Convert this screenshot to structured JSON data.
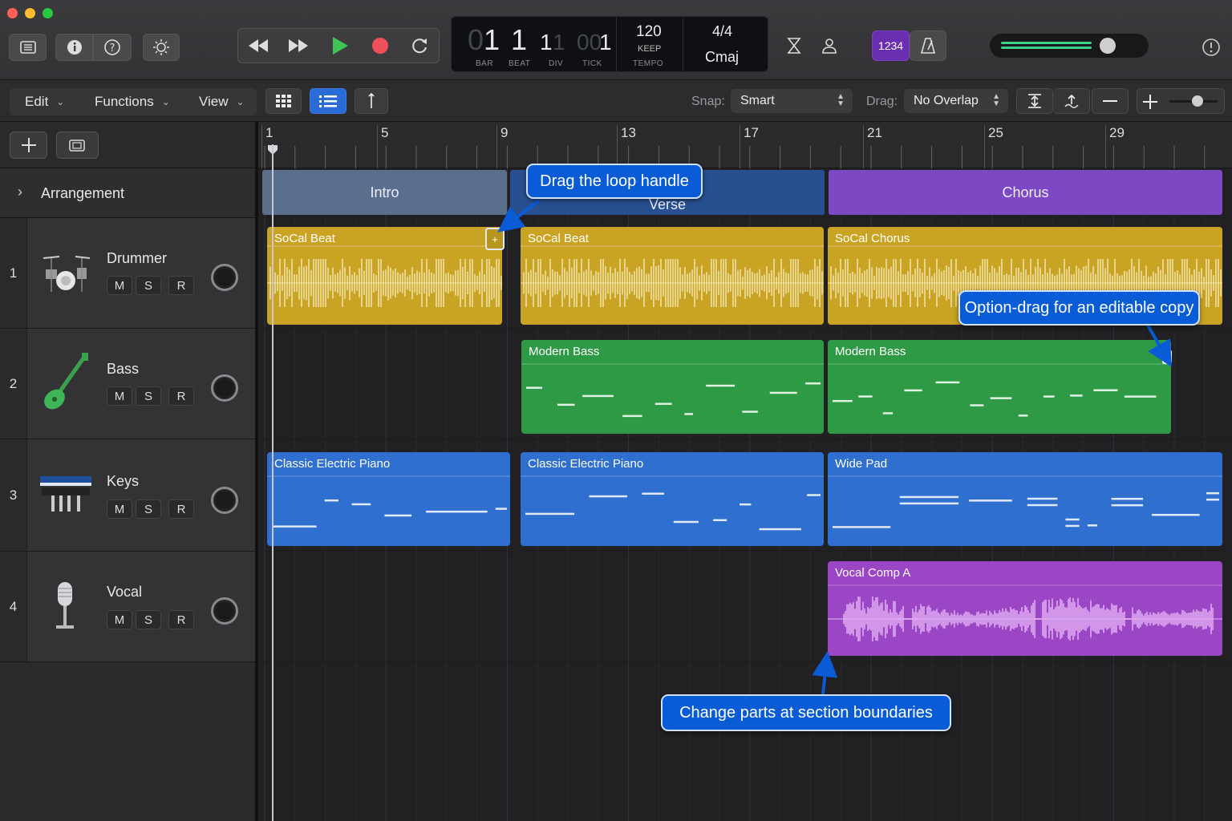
{
  "lcd": {
    "bar": "1",
    "beat": "1",
    "div": "1",
    "tick": "1",
    "bar_lead": "0",
    "div_lead": "1",
    "tick_lead": "00",
    "bar_label": "BAR",
    "beat_label": "BEAT",
    "div_label": "DIV",
    "tick_label": "TICK",
    "tempo": "120",
    "tempo_mode": "KEEP",
    "tempo_label": "TEMPO",
    "signature": "4/4",
    "key": "Cmaj"
  },
  "count_in_label": "1234",
  "toolbar": {
    "edit": "Edit",
    "functions": "Functions",
    "view": "View",
    "snap_label": "Snap:",
    "snap_value": "Smart",
    "drag_label": "Drag:",
    "drag_value": "No Overlap"
  },
  "ruler": {
    "bars": [
      "1",
      "5",
      "9",
      "13",
      "17",
      "21",
      "25",
      "29"
    ]
  },
  "arrangement": {
    "label": "Arrangement",
    "sections": [
      "Intro",
      "Verse",
      "Chorus"
    ]
  },
  "tracks": [
    {
      "number": "1",
      "name": "Drummer",
      "m": "M",
      "s": "S",
      "r": "R"
    },
    {
      "number": "2",
      "name": "Bass",
      "m": "M",
      "s": "S",
      "r": "R"
    },
    {
      "number": "3",
      "name": "Keys",
      "m": "M",
      "s": "S",
      "r": "R"
    },
    {
      "number": "4",
      "name": "Vocal",
      "m": "M",
      "s": "S",
      "r": "R"
    }
  ],
  "regions": {
    "drum1": "SoCal Beat",
    "drum2": "SoCal Beat",
    "drum3": "SoCal Chorus",
    "bass1": "Modern Bass",
    "bass2": "Modern Bass",
    "keys1": "Classic Electric Piano",
    "keys2": "Classic Electric Piano",
    "keys3": "Wide Pad",
    "vocal1": "Vocal Comp A"
  },
  "callouts": {
    "loop": "Drag the loop handle",
    "option": "Option-drag for an editable copy",
    "parts": "Change parts at section boundaries"
  },
  "colors": {
    "drummer": "#c9a424",
    "bass": "#2f9a45",
    "keys": "#2f6fd0",
    "vocal": "#9b46c4",
    "intro": "#5a6f8c",
    "verse": "#284f8f",
    "chorus": "#7d48c4",
    "callout": "#0a5bd6"
  },
  "master_volume": 0.78
}
